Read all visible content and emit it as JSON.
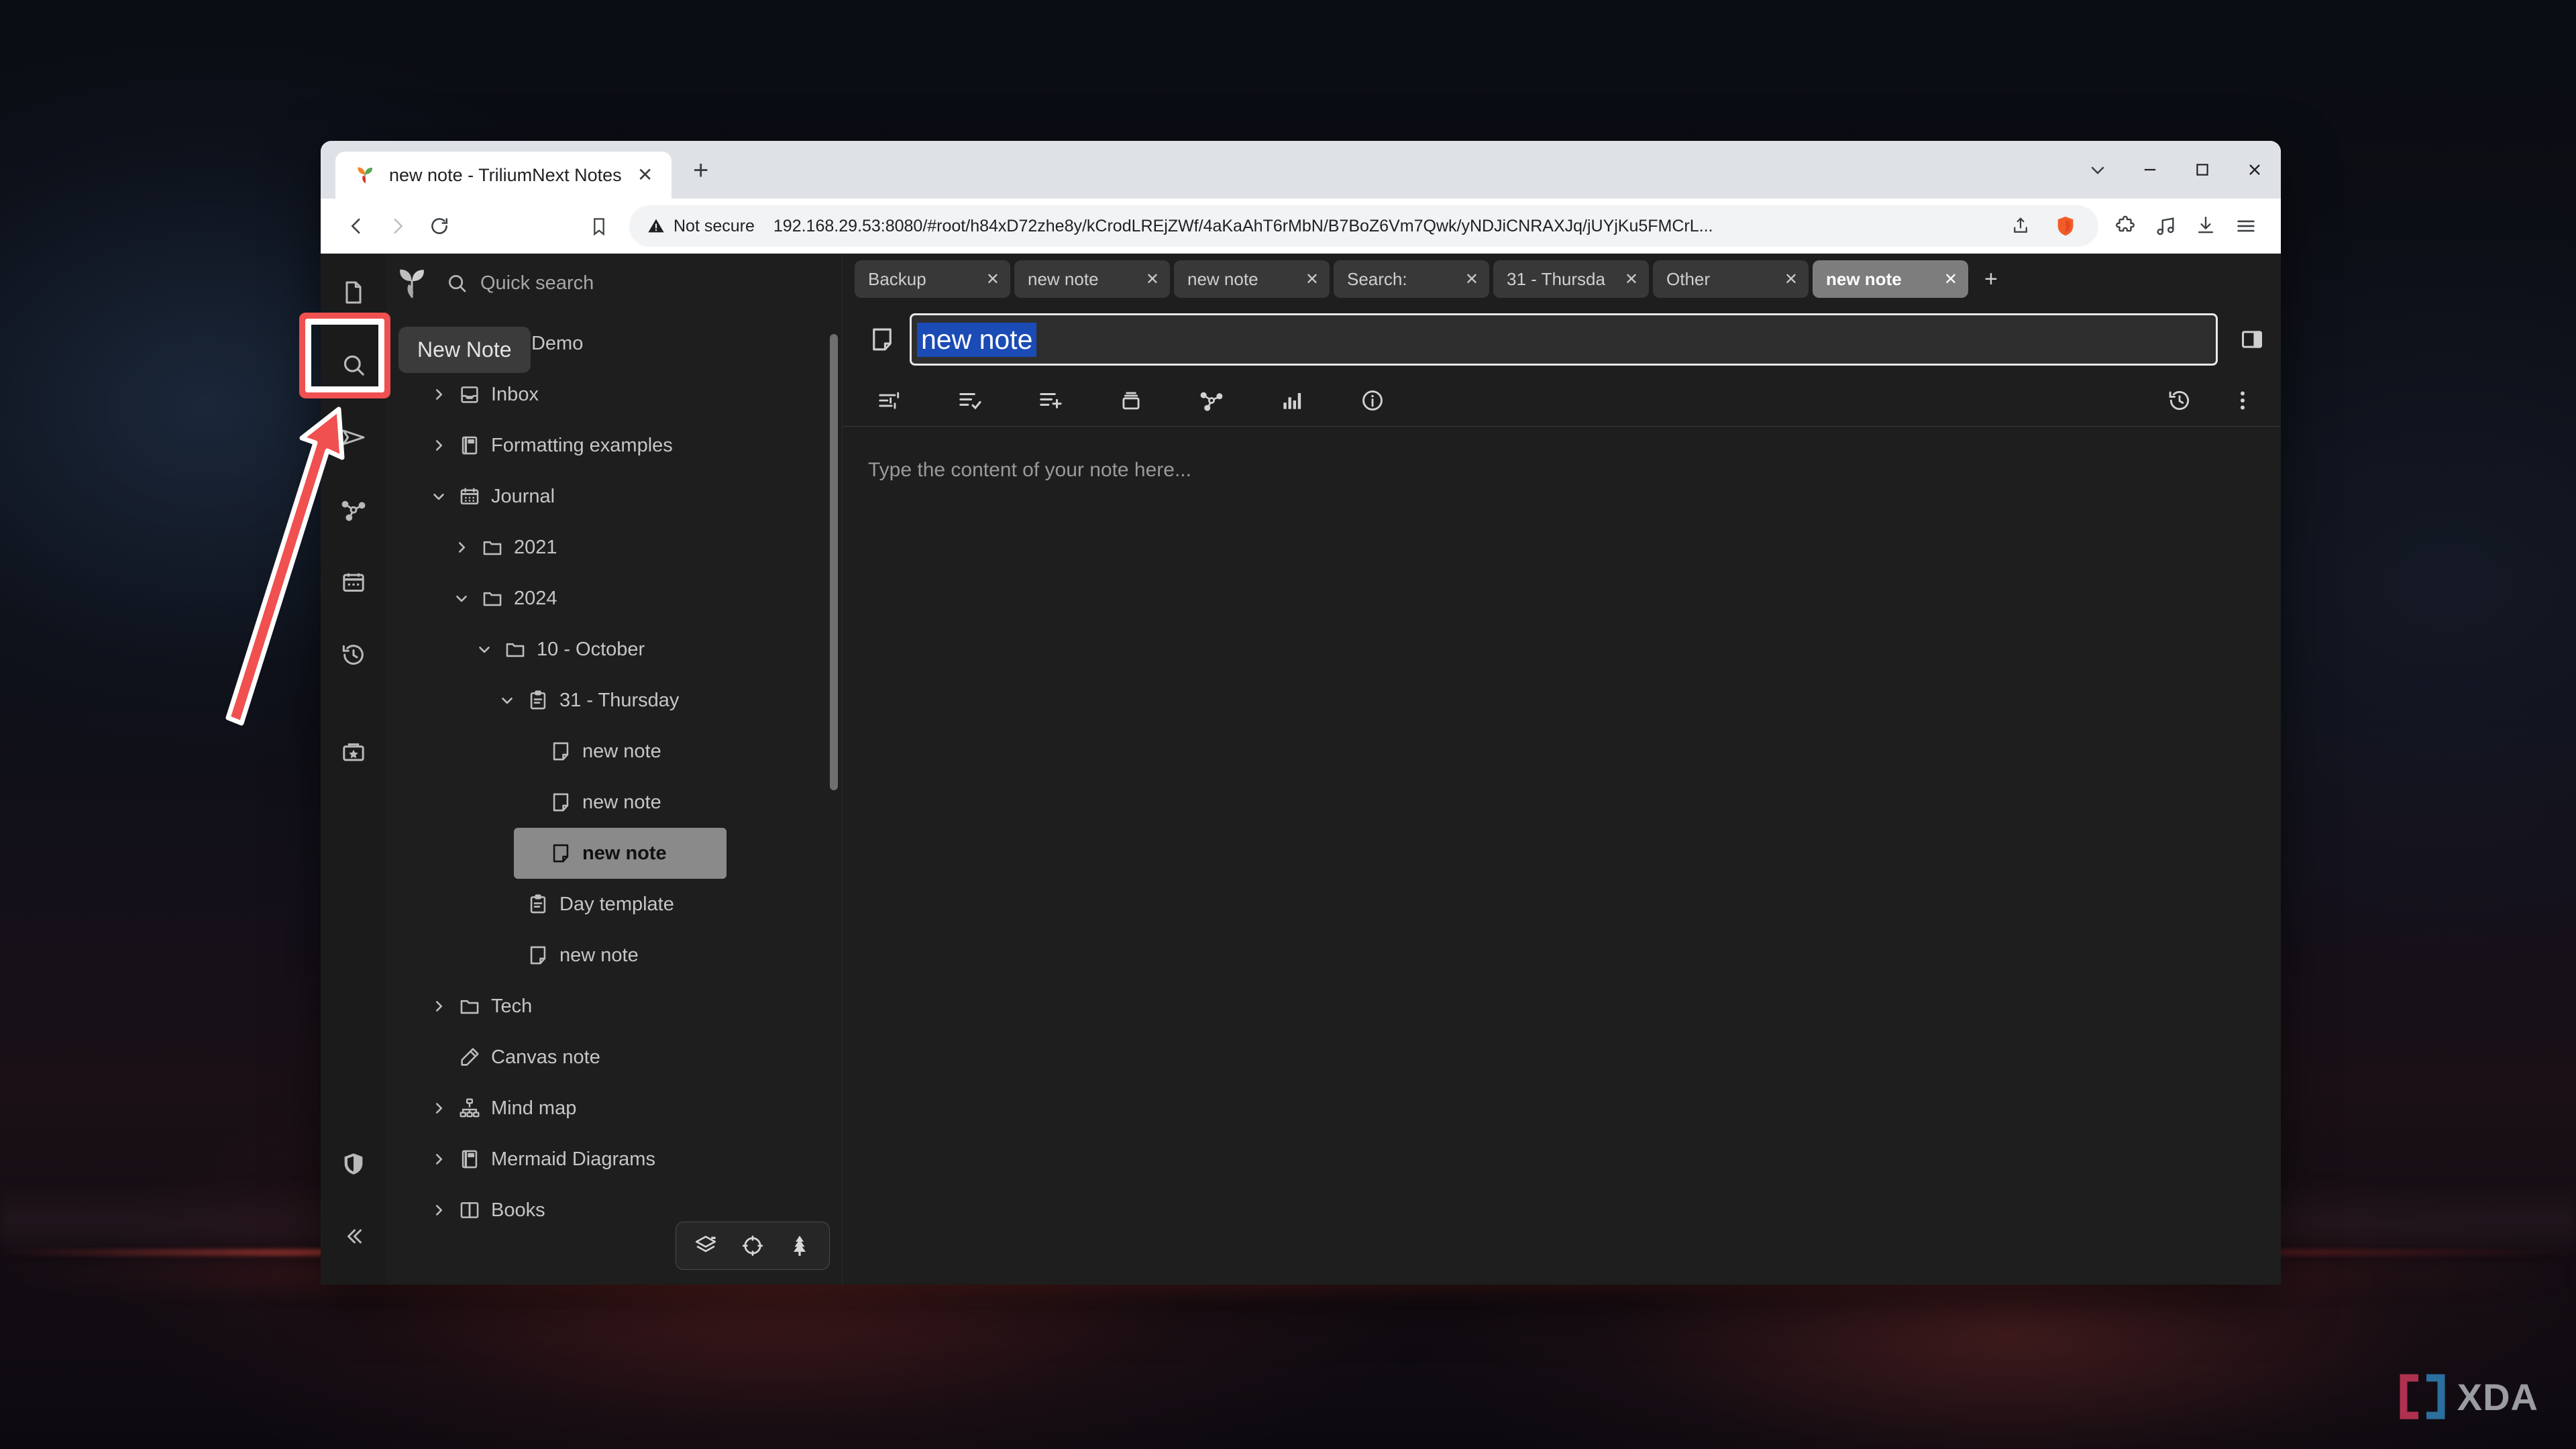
{
  "browser": {
    "tab": {
      "title": "new note - TriliumNext Notes",
      "favicon": "trilium-leaf-icon",
      "close_label": "✕"
    },
    "new_tab_label": "+",
    "window_controls": {
      "chevron": "⌄",
      "minimize": "—",
      "maximize": "▢",
      "close": "✕"
    },
    "nav": {
      "back": "back-icon",
      "forward": "forward-icon",
      "reload": "reload-icon",
      "bookmark": "bookmark-icon"
    },
    "omnibox": {
      "security_label": "Not secure",
      "url": "192.168.29.53:8080/#root/h84xD72zhe8y/kCrodLREjZWf/4aKaAhT6rMbN/B7BoZ6Vm7Qwk/yNDJiCNRAXJq/jUYjKu5FMCrL...",
      "share_icon": "share-icon",
      "shield_icon": "brave-shield-icon"
    },
    "toolbar_icons": [
      "extensions-icon",
      "music-icon",
      "downloads-icon",
      "menu-icon"
    ]
  },
  "app": {
    "rail": [
      {
        "name": "new-note",
        "icon": "document-icon"
      },
      {
        "name": "search",
        "icon": "search-icon"
      },
      {
        "name": "jump-to-note",
        "icon": "send-icon"
      },
      {
        "name": "note-map",
        "icon": "share-nodes-icon"
      },
      {
        "name": "calendar",
        "icon": "calendar-icon"
      },
      {
        "name": "recent-changes",
        "icon": "history-icon"
      },
      {
        "name": "bookmarks",
        "icon": "bookmark-star-icon"
      },
      {
        "name": "protected-session",
        "icon": "shield-icon"
      },
      {
        "name": "collapse-sidebar",
        "icon": "chevrons-left-icon"
      }
    ],
    "quick_search": {
      "placeholder": "Quick search",
      "icon": "search-icon"
    },
    "tooltip": "New Note",
    "tree": [
      {
        "label": "Trilium Demo",
        "icon": "folder-icon",
        "twisty": "down",
        "indent": 0,
        "selected": false
      },
      {
        "label": "Inbox",
        "icon": "inbox-icon",
        "twisty": "right",
        "indent": 1,
        "selected": false
      },
      {
        "label": "Formatting examples",
        "icon": "book-icon",
        "twisty": "right",
        "indent": 1,
        "selected": false
      },
      {
        "label": "Journal",
        "icon": "calendar-icon",
        "twisty": "down",
        "indent": 1,
        "selected": false
      },
      {
        "label": "2021",
        "icon": "folder-icon",
        "twisty": "right",
        "indent": 2,
        "selected": false
      },
      {
        "label": "2024",
        "icon": "folder-icon",
        "twisty": "down",
        "indent": 2,
        "selected": false
      },
      {
        "label": "10 - October",
        "icon": "folder-icon",
        "twisty": "down",
        "indent": 3,
        "selected": false
      },
      {
        "label": "31 - Thursday",
        "icon": "day-icon",
        "twisty": "down",
        "indent": 4,
        "selected": false
      },
      {
        "label": "new note",
        "icon": "note-icon",
        "twisty": "none",
        "indent": 5,
        "selected": false
      },
      {
        "label": "new note",
        "icon": "note-icon",
        "twisty": "none",
        "indent": 5,
        "selected": false
      },
      {
        "label": "new note",
        "icon": "note-icon",
        "twisty": "none",
        "indent": 5,
        "selected": true
      },
      {
        "label": "Day template",
        "icon": "day-icon",
        "twisty": "none",
        "indent": 4,
        "selected": false
      },
      {
        "label": "new note",
        "icon": "note-icon",
        "twisty": "none",
        "indent": 4,
        "selected": false
      },
      {
        "label": "Tech",
        "icon": "folder-icon",
        "twisty": "right",
        "indent": 1,
        "selected": false
      },
      {
        "label": "Canvas note",
        "icon": "pen-icon",
        "twisty": "none",
        "indent": 1,
        "selected": false
      },
      {
        "label": "Mind map",
        "icon": "mindmap-icon",
        "twisty": "right",
        "indent": 1,
        "selected": false
      },
      {
        "label": "Mermaid Diagrams",
        "icon": "book-icon",
        "twisty": "right",
        "indent": 1,
        "selected": false
      },
      {
        "label": "Books",
        "icon": "books-icon",
        "twisty": "right",
        "indent": 1,
        "selected": false
      }
    ],
    "floating_buttons": [
      "layers-icon",
      "target-icon",
      "tree-icon"
    ],
    "note_tabs": [
      {
        "label": "Backup",
        "active": false,
        "close": "✕"
      },
      {
        "label": "new note",
        "active": false,
        "close": "✕"
      },
      {
        "label": "new note",
        "active": false,
        "close": "✕"
      },
      {
        "label": "Search:",
        "active": false,
        "close": "✕"
      },
      {
        "label": "31 - Thursda",
        "active": false,
        "close": "✕"
      },
      {
        "label": "Other",
        "active": false,
        "close": "✕"
      },
      {
        "label": "new note",
        "active": true,
        "close": "✕"
      }
    ],
    "note_tab_add": "+",
    "note": {
      "type_icon": "note-icon",
      "title": "new note",
      "content_placeholder": "Type the content of your note here...",
      "split_icon": "split-pane-icon"
    },
    "note_toolbar": [
      "note-options-icon",
      "promoted-attributes-icon",
      "add-attribute-icon",
      "note-paths-icon",
      "note-map-icon",
      "note-stats-icon",
      "note-info-icon"
    ],
    "note_toolbar_right": [
      "revisions-icon",
      "more-options-icon"
    ]
  },
  "annotations": {
    "highlight_box": {
      "color": "#f05050",
      "target": "new-note-rail-button"
    },
    "arrow": {
      "color": "#f05050",
      "points_to": "new-note-rail-button"
    }
  },
  "watermark": {
    "text": "XDA",
    "bracket_left_color": "#b03050",
    "bracket_right_color": "#2b6f9e"
  }
}
